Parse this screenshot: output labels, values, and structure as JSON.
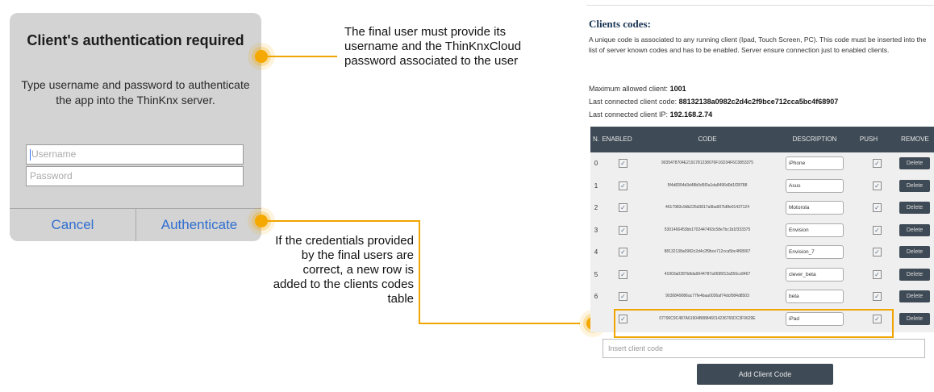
{
  "dialog": {
    "title": "Client's authentication required",
    "message": "Type username and password to authenticate the app into the ThinKnx server.",
    "username_placeholder": "Username",
    "password_placeholder": "Password",
    "cancel_label": "Cancel",
    "authenticate_label": "Authenticate"
  },
  "callouts": {
    "top": "The final user must provide its username and the ThinKnxCloud password associated to the user",
    "bottom": "If the credentials provided by the final users are correct, a new row is added to the clients codes table"
  },
  "clients": {
    "title": "Clients codes:",
    "description": "A unique code is associated to any running client (Ipad, Touch Screen, PC). This code must be inserted into the list of server known codes and has to be enabled. Server ensure connection just to enabled clients.",
    "max_label": "Maximum allowed client:",
    "max_value": "1001",
    "last_code_label": "Last connected client code:",
    "last_code_value": "88132138a0982c2d4c2f9bce712cca5bc4f68907",
    "last_ip_label": "Last connected client IP:",
    "last_ip_value": "192.168.2.74",
    "columns": [
      "N.",
      "ENABLED",
      "CODE",
      "DESCRIPTION",
      "PUSH",
      "REMOVE"
    ],
    "rows": [
      {
        "n": "0",
        "code": "9035478704E2191781238076F16D34F6C0853375",
        "description": "iPhone",
        "remove": "Delete"
      },
      {
        "n": "1",
        "code": "5f4d8394d3d48b0d5f3a1da8496d0d1f28788",
        "description": "Asus",
        "remove": "Delete"
      },
      {
        "n": "2",
        "code": "4617983c9db226d3817a9ba907b8fe01437124",
        "description": "Motorola",
        "remove": "Delete"
      },
      {
        "n": "3",
        "code": "5301466453bb1702447493c58e7bc1b1f333375",
        "description": "Envision",
        "remove": "Delete"
      },
      {
        "n": "4",
        "code": "88132138a0982c2d4c2f9bce712cca5bc4f68907",
        "description": "Envision_7",
        "remove": "Delete"
      },
      {
        "n": "5",
        "code": "41903a0287b8da9644787a0695f12a556cc8467",
        "description": "clever_beta",
        "remove": "Delete"
      },
      {
        "n": "6",
        "code": "9030849086ac77fe4baa0036af74dcf084d8503",
        "description": "beta",
        "remove": "Delete"
      },
      {
        "n": "",
        "code": "07790C9C487A61904B88846014236765DC3F9629E",
        "description": "iPad",
        "remove": "Delete"
      }
    ],
    "insert_placeholder": "Insert client code",
    "add_label": "Add Client Code"
  },
  "colors": {
    "accent": "#f0a500",
    "header": "#3e4a55",
    "dialog_bg": "#d3d3d3",
    "ios_blue": "#2f6ed0"
  }
}
